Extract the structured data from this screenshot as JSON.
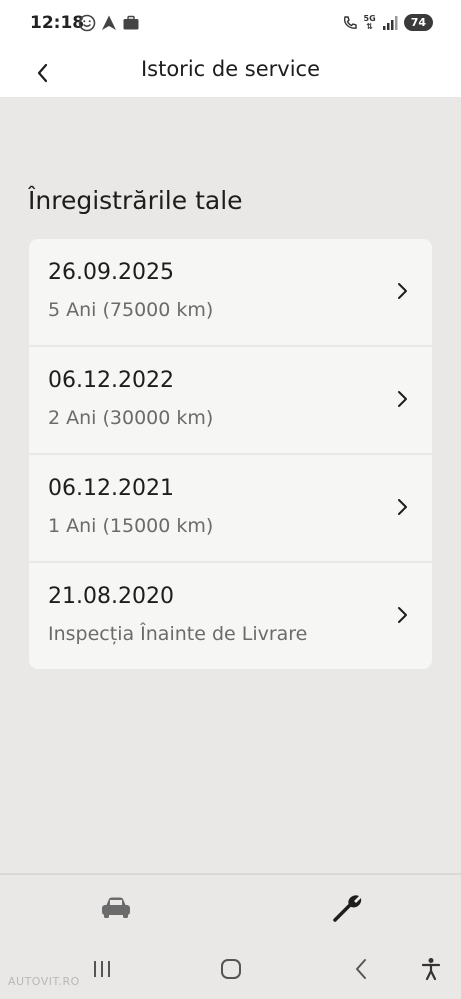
{
  "status_bar": {
    "time": "12:18",
    "network_label": "5G",
    "battery": "74"
  },
  "header": {
    "title": "Istoric de service",
    "back_icon": "chevron-left-icon"
  },
  "section_title": "Înregistrările tale",
  "records": [
    {
      "date": "26.09.2025",
      "description": "5 Ani (75000 km)"
    },
    {
      "date": "06.12.2022",
      "description": "2 Ani (30000 km)"
    },
    {
      "date": "06.12.2021",
      "description": "1 Ani (15000 km)"
    },
    {
      "date": "21.08.2020",
      "description": "Inspecția Înainte de Livrare"
    }
  ],
  "bottom_tabs": {
    "car_icon": "car-icon",
    "service_icon": "wrench-icon"
  },
  "system_nav": {
    "recents_icon": "recents-icon",
    "home_icon": "home-icon",
    "back_icon": "back-icon",
    "accessibility_icon": "accessibility-icon"
  },
  "watermark": "AUTOVIT.RO",
  "colors": {
    "background": "#e9e8e6",
    "card": "#f6f6f5",
    "text_primary": "#1d1d1d",
    "text_secondary": "#6b6b6b"
  }
}
